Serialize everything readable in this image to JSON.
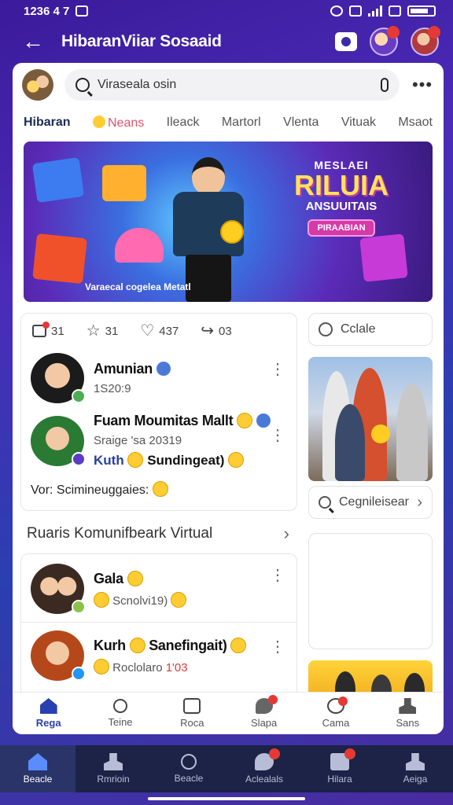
{
  "status_bar": {
    "time": "1236 4 7"
  },
  "app_bar": {
    "title": "HibaranViiar Sosaaid"
  },
  "search": {
    "value": "Viraseala osin"
  },
  "tabs": [
    {
      "label": "Hibaran"
    },
    {
      "label": "Neans"
    },
    {
      "label": "Ileack"
    },
    {
      "label": "Martorl"
    },
    {
      "label": "Vlenta"
    },
    {
      "label": "Vituak"
    },
    {
      "label": "Msaot"
    }
  ],
  "banner": {
    "kicker": "MESLAEI",
    "headline": "RILUIA",
    "subhead": "ANSUUITAIS",
    "pill": "PIRAABIAN",
    "caption": "Varaecal cogelea Metatl"
  },
  "stats": {
    "shares": "31",
    "stars": "31",
    "likes": "437",
    "forwards": "03"
  },
  "posts": [
    {
      "name": "Amunian",
      "meta": "1S20:9"
    },
    {
      "name": "Fuam Moumitas Mallt",
      "meta": "Sraige 'sa 20319",
      "extra_blue": "Kuth",
      "extra": "Sundingeat)"
    }
  ],
  "feed_footer": "Vor: Scimineuggaies:",
  "section_title": "Ruaris Komunifbeark Virtual",
  "posts2": [
    {
      "name": "Gala",
      "meta": "Scnolvi19)"
    },
    {
      "name": "Kurh",
      "name_suffix": "Sanefingait)",
      "meta": "Roclolaro",
      "meta_red": "1'03"
    }
  ],
  "right_panel": {
    "pill_top": "Cclale",
    "pill_mid": "Cegnileisear"
  },
  "inner_nav": [
    {
      "label": "Rega",
      "icon": "home-icon"
    },
    {
      "label": "Teine",
      "icon": "search-icon"
    },
    {
      "label": "Roca",
      "icon": "box-icon"
    },
    {
      "label": "Slapa",
      "icon": "chat-icon"
    },
    {
      "label": "Cama",
      "icon": "camera-icon"
    },
    {
      "label": "Sans",
      "icon": "person-icon"
    }
  ],
  "bottom_nav": [
    {
      "label": "Beacle",
      "icon": "home-icon"
    },
    {
      "label": "Rmrioin",
      "icon": "person-icon"
    },
    {
      "label": "Beacle",
      "icon": "search-icon"
    },
    {
      "label": "Aclealals",
      "icon": "chat-icon"
    },
    {
      "label": "Hilara",
      "icon": "flag-icon"
    },
    {
      "label": "Aeiga",
      "icon": "person-icon"
    }
  ],
  "colors": {
    "accent": "#2a3fb0",
    "badge": "#e53935",
    "banner_headline": "#ffe25a"
  }
}
